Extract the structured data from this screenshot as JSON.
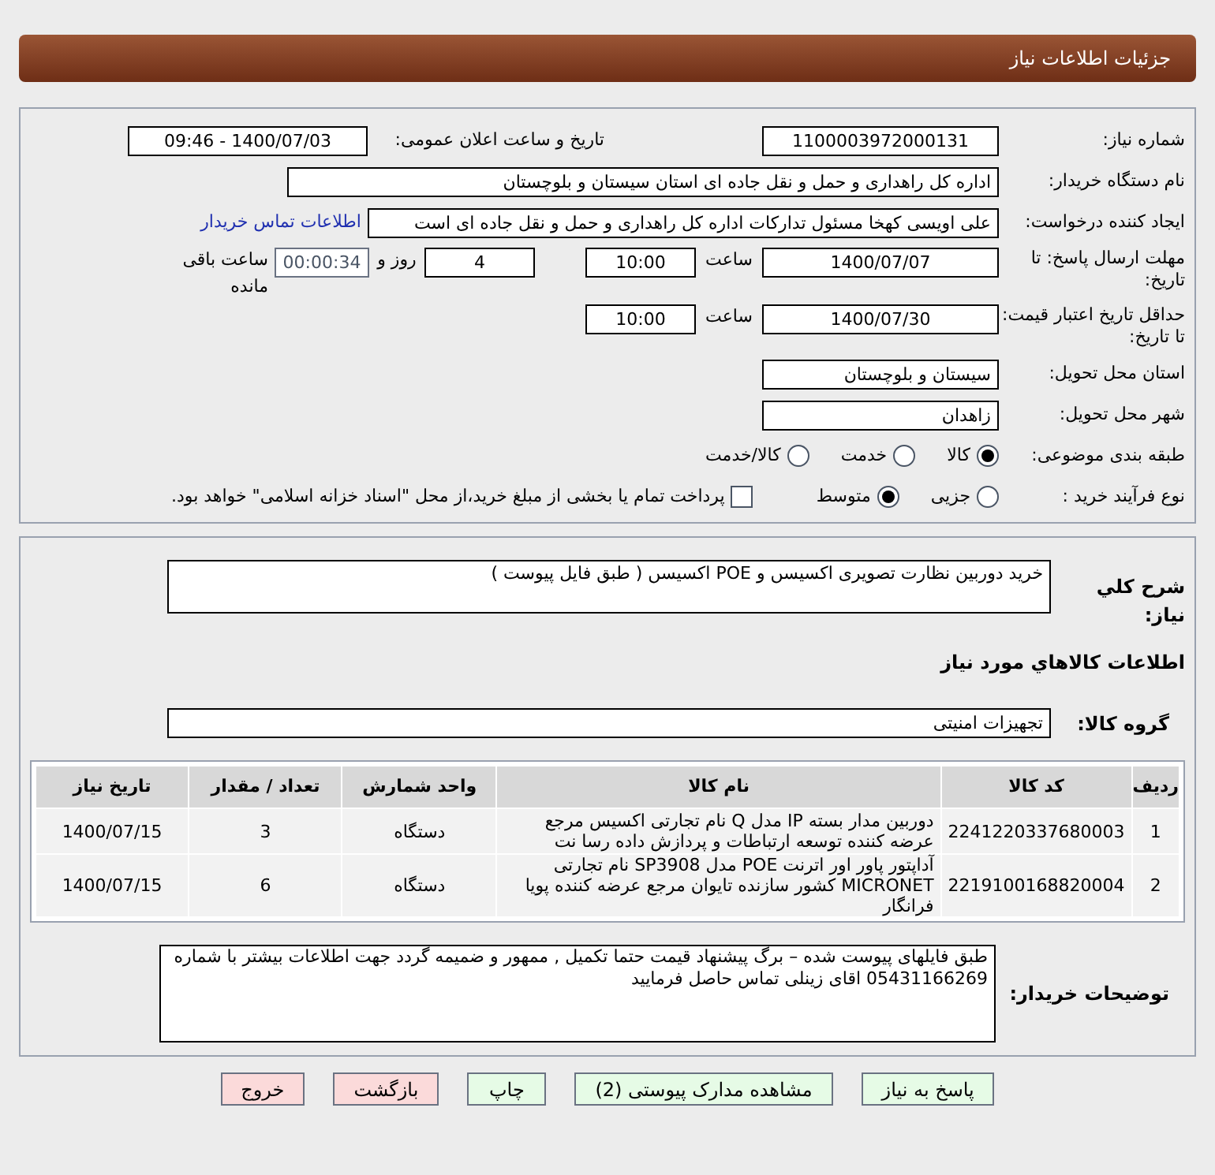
{
  "header": {
    "title": "جزئیات اطلاعات نیاز"
  },
  "need_number": {
    "label": "شماره نیاز:",
    "value": "1100003972000131"
  },
  "announce": {
    "label": "تاریخ و ساعت اعلان عمومی:",
    "value": "1400/07/03 - 09:46"
  },
  "buyer_org": {
    "label": "نام دستگاه خریدار:",
    "value": "اداره کل راهداری و حمل و نقل جاده ای استان سیستان و بلوچستان"
  },
  "requester": {
    "label": "ایجاد کننده درخواست:",
    "value": "علی اویسی کهخا مسئول تدارکات اداره کل راهداری و حمل و نقل جاده ای است",
    "link": "اطلاعات تماس خریدار"
  },
  "deadline": {
    "label": "مهلت ارسال پاسخ: تا تاریخ:",
    "date": "1400/07/07",
    "time_label": "ساعت",
    "time": "10:00",
    "days": "4",
    "days_label": "روز و",
    "remaining": "00:00:34",
    "remaining_label": "ساعت باقی مانده"
  },
  "validity": {
    "label": "حداقل تاریخ اعتبار قیمت: تا تاریخ:",
    "date": "1400/07/30",
    "time_label": "ساعت",
    "time": "10:00"
  },
  "province": {
    "label": "استان محل تحویل:",
    "value": "سیستان و بلوچستان"
  },
  "city": {
    "label": "شهر محل تحویل:",
    "value": "زاهدان"
  },
  "category": {
    "label": "طبقه بندی موضوعی:",
    "options": [
      {
        "label": "کالا",
        "selected": true
      },
      {
        "label": "خدمت",
        "selected": false
      },
      {
        "label": "کالا/خدمت",
        "selected": false
      }
    ]
  },
  "process": {
    "label": "نوع فرآیند خرید :",
    "options": [
      {
        "label": "جزیی",
        "selected": false
      },
      {
        "label": "متوسط",
        "selected": true
      }
    ],
    "treasury": {
      "label": "پرداخت تمام یا بخشی از مبلغ خرید،از محل \"اسناد خزانه اسلامی\" خواهد بود.",
      "checked": false
    }
  },
  "description": {
    "label": "شرح کلي نياز:",
    "value": "خرید دوربین نظارت تصویری اکسیسں و POE اکسیسں ( طبق فایل پیوست )"
  },
  "goods_title": "اطلاعات کالاهاي مورد نياز",
  "goods_group": {
    "label": "گروه کالا:",
    "value": "تجهیزات امنیتی"
  },
  "table": {
    "columns": [
      "ردیف",
      "کد کالا",
      "نام کالا",
      "واحد شمارش",
      "تعداد / مقدار",
      "تاریخ نیاز"
    ],
    "rows": [
      [
        "1",
        "2241220337680003",
        "دوربین مدار بسته IP مدل Q نام تجارتی اکسیس مرجع عرضه کننده توسعه ارتباطات و پردازش داده رسا نت",
        "دستگاه",
        "3",
        "1400/07/15"
      ],
      [
        "2",
        "2219100168820004",
        "آداپتور پاور اور اترنت POE مدل SP3908 نام تجارتی MICRONET کشور سازنده تایوان مرجع عرضه کننده پویا فرانگار",
        "دستگاه",
        "6",
        "1400/07/15"
      ]
    ]
  },
  "buyer_notes": {
    "label": "توضیحات خریدار:",
    "value": "طبق فایلهای پیوست شده – برگ پیشنهاد قیمت حتما تکمیل , ممهور و ضمیمه گردد جهت اطلاعات بیشتر با شماره 05431166269 اقای زینلی  تماس حاصل فرمایید"
  },
  "buttons": [
    {
      "label": "پاسخ به نیاز",
      "kind": "normal"
    },
    {
      "label": "مشاهده مدارک پیوستی (2)",
      "kind": "normal"
    },
    {
      "label": "چاپ",
      "kind": "normal"
    },
    {
      "label": "بازگشت",
      "kind": "danger"
    },
    {
      "label": "خروج",
      "kind": "danger"
    }
  ]
}
